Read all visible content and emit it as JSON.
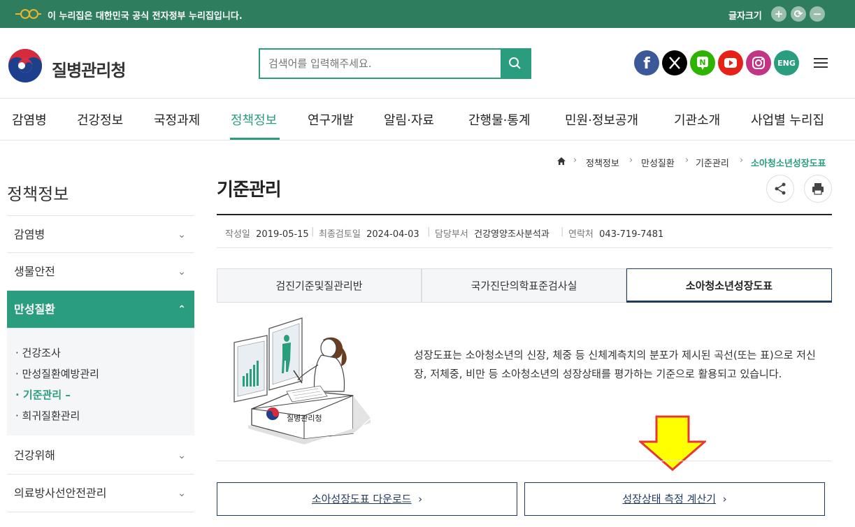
{
  "topbar": {
    "notice": "이 누리집은 대한민국 공식 전자정부 누리집입니다.",
    "font_size_label": "글자크기",
    "font_plus": "+",
    "font_reset": "⟳",
    "font_minus": "−"
  },
  "header": {
    "logo_text": "질병관리청",
    "search_placeholder": "검색어를 입력해주세요.",
    "social": [
      {
        "name": "facebook",
        "color": "#3b5998",
        "glyph": "f"
      },
      {
        "name": "x",
        "color": "#000000",
        "glyph": "𝕏"
      },
      {
        "name": "naver-blog",
        "color": "#2db400",
        "glyph": "N"
      },
      {
        "name": "youtube",
        "color": "#e62117",
        "glyph": "▶"
      },
      {
        "name": "instagram",
        "color": "#c13584",
        "glyph": "◎"
      },
      {
        "name": "english",
        "color": "#2a9d7f",
        "glyph": "ENG"
      }
    ]
  },
  "gnb": {
    "items": [
      "감염병",
      "건강정보",
      "국정과제",
      "정책정보",
      "연구개발",
      "알림·자료",
      "간행물·통계",
      "민원·정보공개",
      "기관소개",
      "사업별 누리집"
    ],
    "active": "정책정보"
  },
  "sidebar": {
    "title": "정책정보",
    "items": [
      "감염병",
      "생물안전",
      "만성질환",
      "건강위해",
      "의료방사선안전관리"
    ],
    "active": "만성질환",
    "sub_items": [
      "건강조사",
      "만성질환예방관리",
      "기준관리",
      "희귀질환관리"
    ],
    "active_sub": "기준관리"
  },
  "breadcrumb": [
    "정책정보",
    "만성질환",
    "기준관리",
    "소아청소년성장도표"
  ],
  "page": {
    "title": "기준관리",
    "meta": [
      {
        "key": "작성일",
        "value": "2019-05-15"
      },
      {
        "key": "최종검토일",
        "value": "2024-04-03"
      },
      {
        "key": "담당부서",
        "value": "건강영양조사분석과"
      },
      {
        "key": "연락처",
        "value": "043-719-7481"
      }
    ],
    "tabs": [
      "검진기준및질관리반",
      "국가진단의학표준검사실",
      "소아청소년성장도표"
    ],
    "active_tab": "소아청소년성장도표",
    "illustration_label": "질병관리청",
    "description": "성장도표는 소아청소년의 신장, 체중 등 신체계측치의 분포가 제시된 곡선(또는 표)으로 저신장, 저체중, 비만 등 소아청소년의 성장상태를 평가하는 기준으로 활용되고 있습니다.",
    "buttons": [
      "소아성장도표 다운로드",
      "성장상태 측정 계산기"
    ],
    "button_arrow": "›"
  },
  "colors": {
    "primary": "#2a9d7f",
    "topbar": "#2e7d5e",
    "navy": "#1f3a5f",
    "annotation_arrow": "#ffff00"
  }
}
